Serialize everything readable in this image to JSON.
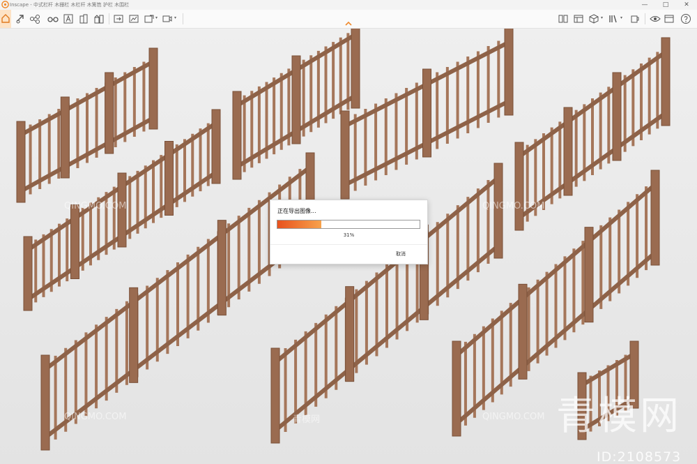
{
  "titlebar": {
    "title": "Inscape - 中式栏杆 木栅栏 木栏杆 木篱笆 护栏 木围栏",
    "minimize": "—",
    "maximize": "□",
    "close": "✕"
  },
  "toolbar": {
    "tools": [
      "home-icon",
      "link-icon",
      "node-icon",
      "glasses-icon",
      "binoculars-icon",
      "shape-icon",
      "building-icon",
      "buildings-icon",
      "door-icon",
      "export-icon",
      "render-icon",
      "paint-icon",
      "window-icon",
      "book-icon",
      "box-icon",
      "layout-icon",
      "eye-icon",
      "mug-icon",
      "help-icon"
    ],
    "dropdown": "▾"
  },
  "viewport": {
    "watermark_text": "QINGMO.COM",
    "watermark_big": "青模网",
    "watermark_cn": "青模网",
    "id_label": "ID:2108573"
  },
  "dialog": {
    "title": "正在导出图像...",
    "progress": 0.31,
    "percent_label": "31%",
    "cancel_label": "取消"
  },
  "colors": {
    "accent": "#f08a2c",
    "progress_start": "#e8521e",
    "progress_end": "#f7a24c",
    "wood": "#a5765a"
  }
}
